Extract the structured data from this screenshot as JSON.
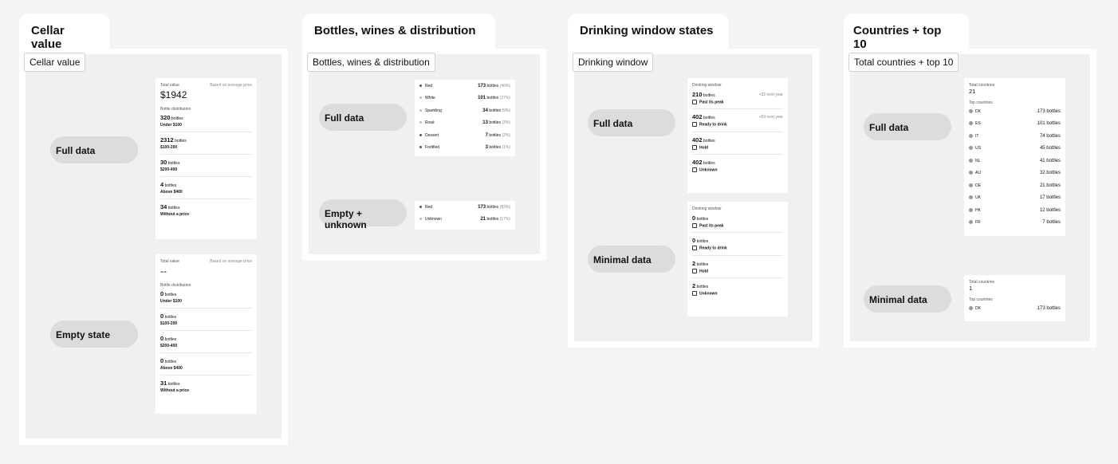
{
  "cellar": {
    "tab": "Cellar value",
    "label": "Cellar value",
    "state_full": "Full data",
    "state_empty": "Empty state",
    "full": {
      "total_label": "Total value",
      "basis": "Based on average price",
      "value": "$1942",
      "dist_label": "Bottle distribution",
      "unit": "bottles",
      "rows": [
        {
          "count": "320",
          "range": "Under $100"
        },
        {
          "count": "2312",
          "range": "$100-200"
        },
        {
          "count": "30",
          "range": "$200-400"
        },
        {
          "count": "4",
          "range": "Above $400"
        },
        {
          "count": "34",
          "range": "Without a price"
        }
      ]
    },
    "empty": {
      "total_label": "Total value",
      "basis": "Based on average price",
      "value": "--",
      "dist_label": "Bottle distribution",
      "unit": "bottles",
      "rows": [
        {
          "count": "0",
          "range": "Under $100"
        },
        {
          "count": "0",
          "range": "$100-200"
        },
        {
          "count": "0",
          "range": "$200-400"
        },
        {
          "count": "0",
          "range": "Above $400"
        },
        {
          "count": "31",
          "range": "Without a price"
        }
      ]
    }
  },
  "bottles": {
    "tab": "Bottles, wines & distribution",
    "label": "Bottles, wines & distribution",
    "state_full": "Full data",
    "state_empty": "Empty + unknown",
    "full": [
      {
        "name": "Red",
        "count": "173",
        "unit": "bottles",
        "pct": "(46%)",
        "dark": true
      },
      {
        "name": "White",
        "count": "101",
        "unit": "bottles",
        "pct": "(27%)",
        "dark": false
      },
      {
        "name": "Sparkling",
        "count": "34",
        "unit": "bottles",
        "pct": "(9%)",
        "dark": false
      },
      {
        "name": "Rosé",
        "count": "13",
        "unit": "bottles",
        "pct": "(3%)",
        "dark": false
      },
      {
        "name": "Dessert",
        "count": "7",
        "unit": "bottles",
        "pct": "(2%)",
        "dark": true
      },
      {
        "name": "Fortified",
        "count": "3",
        "unit": "bottles",
        "pct": "(1%)",
        "dark": true
      }
    ],
    "empty": [
      {
        "name": "Red",
        "count": "173",
        "unit": "bottles",
        "pct": "(83%)",
        "dark": true
      },
      {
        "name": "Unknown",
        "count": "21",
        "unit": "bottles",
        "pct": "(17%)",
        "dark": false
      }
    ]
  },
  "drinking": {
    "tab": "Drinking window states",
    "label": "Drinking window",
    "state_full": "Full data",
    "state_min": "Minimal data",
    "title": "Drinking window",
    "unit": "bottles",
    "full": [
      {
        "count": "210",
        "status": "Past its peak",
        "note": "+32 next year"
      },
      {
        "count": "402",
        "status": "Ready to drink",
        "note": "+59 next year"
      },
      {
        "count": "402",
        "status": "Hold",
        "note": ""
      },
      {
        "count": "402",
        "status": "Unknown",
        "note": ""
      }
    ],
    "min": [
      {
        "count": "0",
        "status": "Past its peak"
      },
      {
        "count": "0",
        "status": "Ready to drink"
      },
      {
        "count": "2",
        "status": "Hold"
      },
      {
        "count": "2",
        "status": "Unknown"
      }
    ]
  },
  "countries": {
    "tab": "Countries + top 10",
    "label": "Total countries + top 10",
    "state_full": "Full data",
    "state_min": "Minimal data",
    "total_label": "Total countries",
    "top_label": "Top countries",
    "full_total": "21",
    "min_total": "1",
    "full": [
      {
        "code": "DK",
        "value": "173 bottles"
      },
      {
        "code": "ES",
        "value": "101 bottles"
      },
      {
        "code": "IT",
        "value": "74 bottles"
      },
      {
        "code": "US",
        "value": "45 bottles"
      },
      {
        "code": "NL",
        "value": "41 bottles"
      },
      {
        "code": "AU",
        "value": "32 bottles"
      },
      {
        "code": "DE",
        "value": "21 bottles"
      },
      {
        "code": "UK",
        "value": "17 bottles"
      },
      {
        "code": "HK",
        "value": "12 bottles"
      },
      {
        "code": "FR",
        "value": "7 bottles"
      }
    ],
    "min": [
      {
        "code": "DK",
        "value": "173 bottles"
      }
    ]
  }
}
